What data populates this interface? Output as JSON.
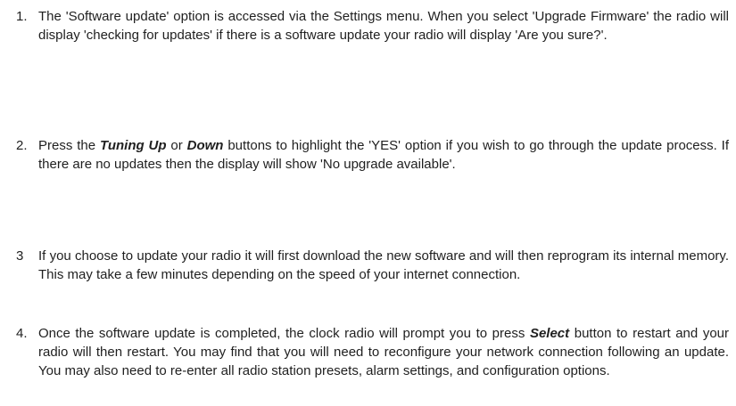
{
  "steps": [
    {
      "number": "1.",
      "text": "The 'Software update' option is accessed via the Settings menu. When you select 'Upgrade Firmware' the radio will display 'checking for updates' if there is a software update your radio will display 'Are you sure?'."
    },
    {
      "number": "2.",
      "before": "Press the ",
      "emph1": "Tuning Up",
      "middle": " or ",
      "emph2": "Down",
      "after": " buttons to highlight the 'YES' option if you wish to go through the update process. If there are no updates then the display will show 'No upgrade available'."
    },
    {
      "number": "3",
      "text": "If you choose to update your radio it will first download the new software and will then reprogram its internal memory. This may take a few minutes depending on the speed of your internet connection."
    },
    {
      "number": "4.",
      "before": "Once the software update is completed, the clock radio will prompt you to press ",
      "emph1": "Select",
      "after": "  button to restart and your radio will then restart. You may find that you will need to reconfigure your network connection following an update. You may also need to re-enter all radio station presets, alarm settings, and configuration options."
    }
  ]
}
